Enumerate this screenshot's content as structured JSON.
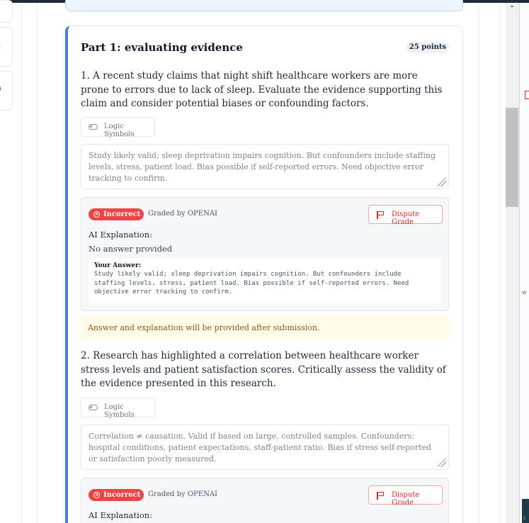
{
  "part": {
    "title": "Part 1: evaluating evidence",
    "points": "25 points"
  },
  "questions": [
    {
      "prompt": "1. A recent study claims that night shift healthcare workers are more prone to errors due to lack of sleep. Evaluate the evidence supporting this claim and consider potential biases or confounding factors.",
      "logic_button": "Logic Symbols",
      "answer": "Study likely valid; sleep deprivation impairs cognition. But confounders include staffing levels, stress, patient load. Bias possible if self-reported errors. Need objective error tracking to confirm.",
      "status": "Incorrect",
      "graded_by": "Graded by OPENAI",
      "dispute_label": "Dispute Grade",
      "ai_explanation_label": "AI Explanation:",
      "ai_explanation": "No answer provided",
      "your_answer_label": "Your Answer:",
      "your_answer": "Study likely valid; sleep deprivation impairs cognition. But confounders include staffing levels, stress, patient load. Bias possible if self-reported errors. Need objective error tracking to confirm.",
      "notice": "Answer and explanation will be provided after submission."
    },
    {
      "prompt": "2. Research has highlighted a correlation between healthcare worker stress levels and patient satisfaction scores. Critically assess the validity of the evidence presented in this research.",
      "logic_button": "Logic Symbols",
      "answer": "Correlation ≠ causation. Valid if based on large, controlled samples. Confounders: hospital conditions, patient expectations, staff-patient ratio. Bias if stress self-reported or satisfaction poorly measured.",
      "status": "Incorrect",
      "graded_by": "Graded by OPENAI",
      "dispute_label": "Dispute Grade",
      "ai_explanation_label": "AI Explanation:"
    }
  ],
  "colors": {
    "accent": "#4a7fe0",
    "incorrect": "#ef4444",
    "dispute": "#dc2626",
    "notice_bg": "#fefbe8",
    "notice_text": "#8a5a10"
  },
  "icons": {
    "logic": "toggle-icon",
    "status": "x-circle-icon",
    "dispute": "flag-icon",
    "resize": "resize-handle-icon",
    "scroll": "chevron-up-icon"
  },
  "right_edge": {
    "fragment": "w"
  },
  "scrollbar": {
    "up_glyph": "⌃"
  }
}
